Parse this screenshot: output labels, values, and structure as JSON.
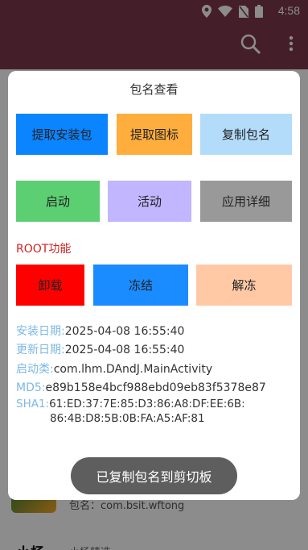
{
  "status_bar": {
    "time": "4:58"
  },
  "background": {
    "package_text": "包名：com.bsit.wftong",
    "app_title": "小杨",
    "app_subtitle": "小杨精选"
  },
  "dialog": {
    "title": "包名查看",
    "buttons_row1": [
      {
        "label": "提取安装包",
        "color": "#0a84ff"
      },
      {
        "label": "提取图标",
        "color": "#ffad3d"
      },
      {
        "label": "复制包名",
        "color": "#b3dcfb"
      }
    ],
    "buttons_row2": [
      {
        "label": "启动",
        "color": "#5ccf73"
      },
      {
        "label": "活动",
        "color": "#c1b6ff"
      },
      {
        "label": "应用详细",
        "color": "#999999"
      }
    ],
    "root_label": "ROOT功能",
    "buttons_row3": [
      {
        "label": "卸载",
        "color": "#ff0000"
      },
      {
        "label": "冻结",
        "color": "#1a8cff"
      },
      {
        "label": "解冻",
        "color": "#ffc9a6"
      }
    ],
    "info": {
      "install_date_key": "安装日期:",
      "install_date": "2025-04-08 16:55:40",
      "update_date_key": "更新日期:",
      "update_date": "2025-04-08 16:55:40",
      "launch_class_key": "启动类:",
      "launch_class": "com.lhm.DAndJ.MainActivity",
      "md5_key": "MD5:",
      "md5": "e89b158e4bcf988ebd09eb83f5378e87",
      "sha1_key": "SHA1:",
      "sha1_line1": "61:ED:37:7E:85:D3:86:A8:DF:EE:6B:",
      "sha1_line2": "86:4B:D8:5B:0B:FA:A5:AF:81"
    }
  },
  "toast": {
    "message": "已复制包名到剪切板"
  }
}
